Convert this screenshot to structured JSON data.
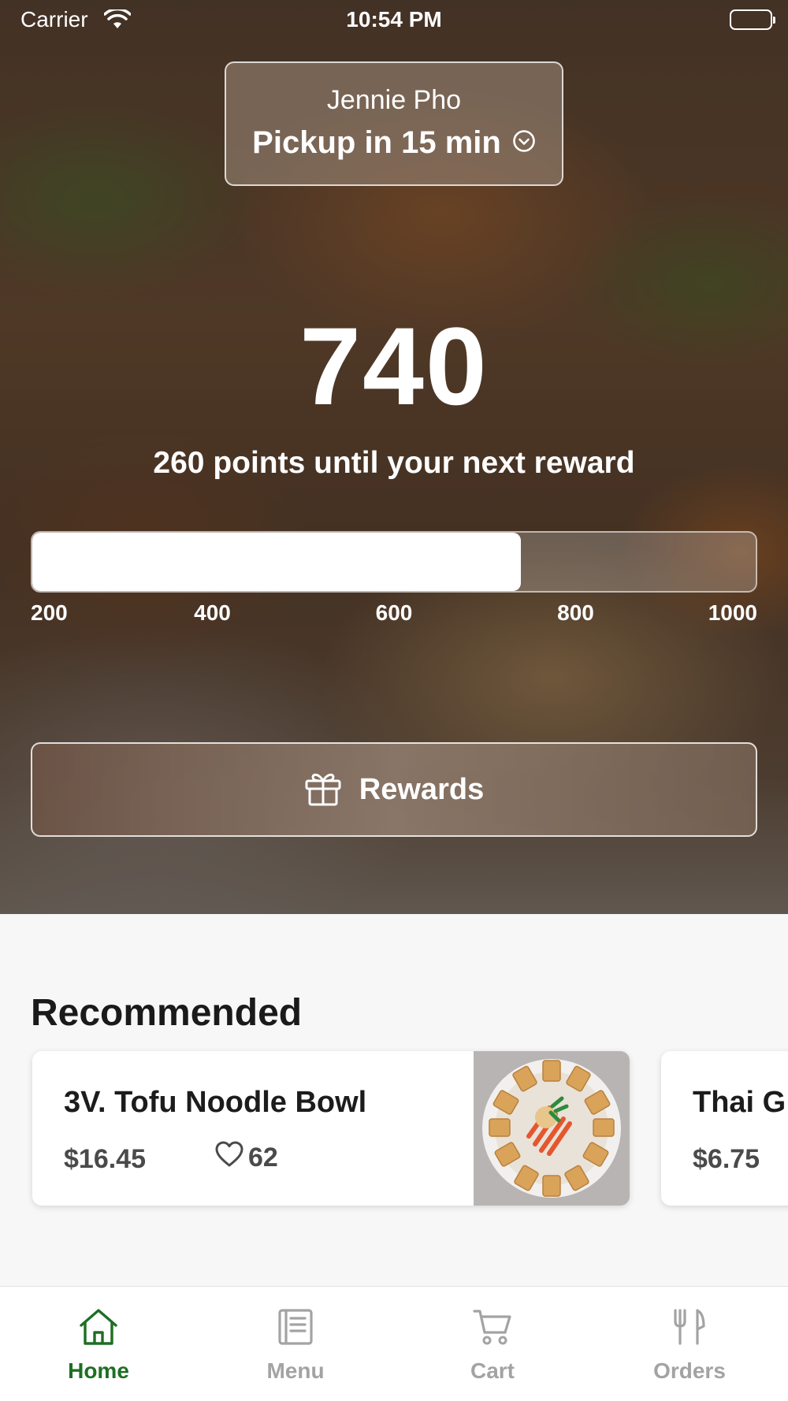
{
  "status_bar": {
    "carrier": "Carrier",
    "time": "10:54 PM"
  },
  "location": {
    "store_name": "Jennie Pho",
    "pickup": "Pickup in 15 min"
  },
  "points": {
    "value": "740",
    "caption": "260 points until your next reward",
    "current": 740,
    "range": [
      200,
      1000
    ],
    "ticks": [
      "200",
      "400",
      "600",
      "800",
      "1000"
    ]
  },
  "rewards_button": {
    "label": "Rewards",
    "icon": "gift-icon"
  },
  "recommended": {
    "title": "Recommended",
    "items": [
      {
        "name": "3V. Tofu Noodle Bowl",
        "price": "$16.45",
        "likes": "62"
      },
      {
        "name": "Thai G",
        "price": "$6.75"
      }
    ]
  },
  "tab_bar": {
    "active_color": "#1d6f23",
    "inactive_color": "#a3a3a3",
    "tabs": [
      {
        "label": "Home",
        "icon": "home-icon",
        "active": true
      },
      {
        "label": "Menu",
        "icon": "menu-icon",
        "active": false
      },
      {
        "label": "Cart",
        "icon": "cart-icon",
        "active": false
      },
      {
        "label": "Orders",
        "icon": "utensils-icon",
        "active": false
      }
    ]
  }
}
